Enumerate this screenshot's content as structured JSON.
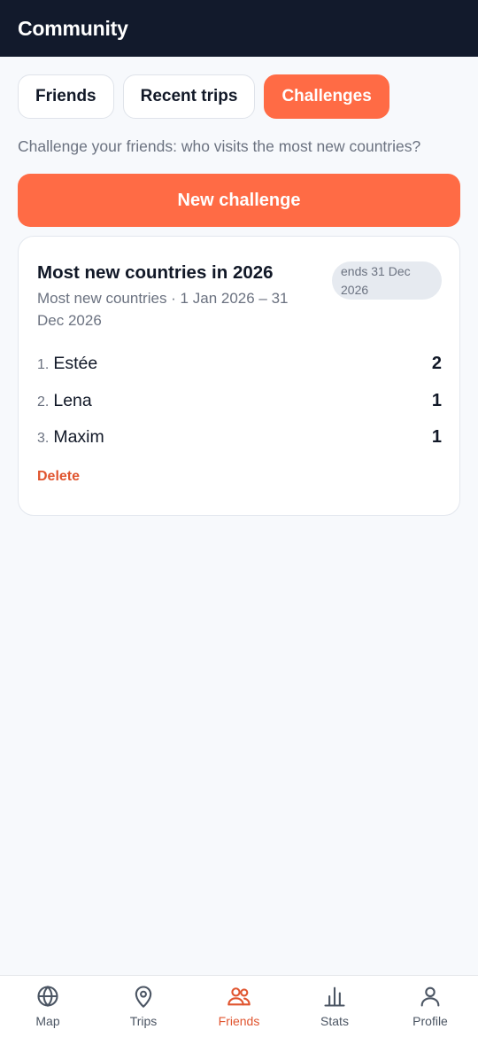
{
  "header": {
    "title": "Community"
  },
  "tabs": [
    {
      "label": "Friends",
      "active": false
    },
    {
      "label": "Recent trips",
      "active": false
    },
    {
      "label": "Challenges",
      "active": true
    }
  ],
  "intro": "Challenge your friends: who visits the most new countries?",
  "new_challenge_label": "New challenge",
  "challenge": {
    "title": "Most new countries in 2026",
    "meta": "Most new countries · 1 Jan 2026 – 31 Dec 2026",
    "badge": "ends 31 Dec 2026",
    "rankings": [
      {
        "rank": "1.",
        "name": "Estée",
        "count": "2"
      },
      {
        "rank": "2.",
        "name": "Lena",
        "count": "1"
      },
      {
        "rank": "3.",
        "name": "Maxim",
        "count": "1"
      }
    ],
    "delete_label": "Delete"
  },
  "nav": [
    {
      "label": "Map",
      "icon": "globe-icon",
      "active": false
    },
    {
      "label": "Trips",
      "icon": "map-pin-icon",
      "active": false
    },
    {
      "label": "Friends",
      "icon": "users-icon",
      "active": true
    },
    {
      "label": "Stats",
      "icon": "bar-chart-icon",
      "active": false
    },
    {
      "label": "Profile",
      "icon": "user-icon",
      "active": false
    }
  ],
  "colors": {
    "accent": "#ff6b45",
    "accent_text": "#e0552f",
    "header_bg": "#121a2c",
    "muted": "#6b7280",
    "nav_icon": "#4b5563"
  }
}
